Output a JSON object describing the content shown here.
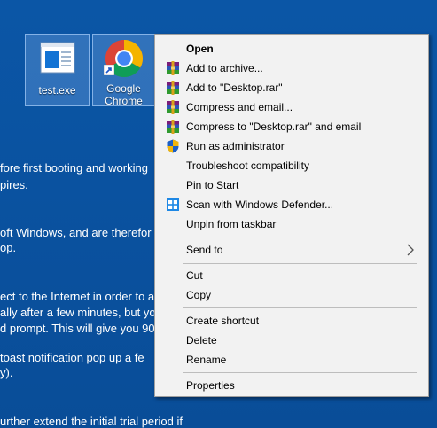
{
  "desktop": {
    "background_color": "#0b56a6",
    "icons": [
      {
        "label": "test.exe",
        "icon": "exe-file-icon"
      },
      {
        "label": "Google\nChrome",
        "icon": "chrome-icon"
      }
    ],
    "background_text": [
      "fore first booting and working",
      "pires.",
      "oft Windows, and are therefor",
      "op.",
      "ect to the Internet in order to a",
      "ally after a few minutes, but yo",
      "d prompt. This will give you 90",
      "toast notification pop up a fe",
      "y).",
      "urther extend the initial trial period if"
    ]
  },
  "context_menu": {
    "items": [
      {
        "label": "Open",
        "icon": ""
      },
      {
        "label": "Add to archive...",
        "icon": "winrar-icon"
      },
      {
        "label": "Add to \"Desktop.rar\"",
        "icon": "winrar-icon"
      },
      {
        "label": "Compress and email...",
        "icon": "winrar-icon"
      },
      {
        "label": "Compress to \"Desktop.rar\" and email",
        "icon": "winrar-icon"
      },
      {
        "label": "Run as administrator",
        "icon": "uac-shield-icon"
      },
      {
        "label": "Troubleshoot compatibility",
        "icon": ""
      },
      {
        "label": "Pin to Start",
        "icon": ""
      },
      {
        "label": "Scan with Windows Defender...",
        "icon": "windows-defender-icon"
      },
      {
        "label": "Unpin from taskbar",
        "icon": ""
      },
      {
        "label": "Send to",
        "icon": "",
        "submenu_icon": "chevron-right-icon"
      },
      {
        "label": "Cut",
        "icon": ""
      },
      {
        "label": "Copy",
        "icon": ""
      },
      {
        "label": "Create shortcut",
        "icon": ""
      },
      {
        "label": "Delete",
        "icon": ""
      },
      {
        "label": "Rename",
        "icon": ""
      },
      {
        "label": "Properties",
        "icon": ""
      }
    ]
  }
}
